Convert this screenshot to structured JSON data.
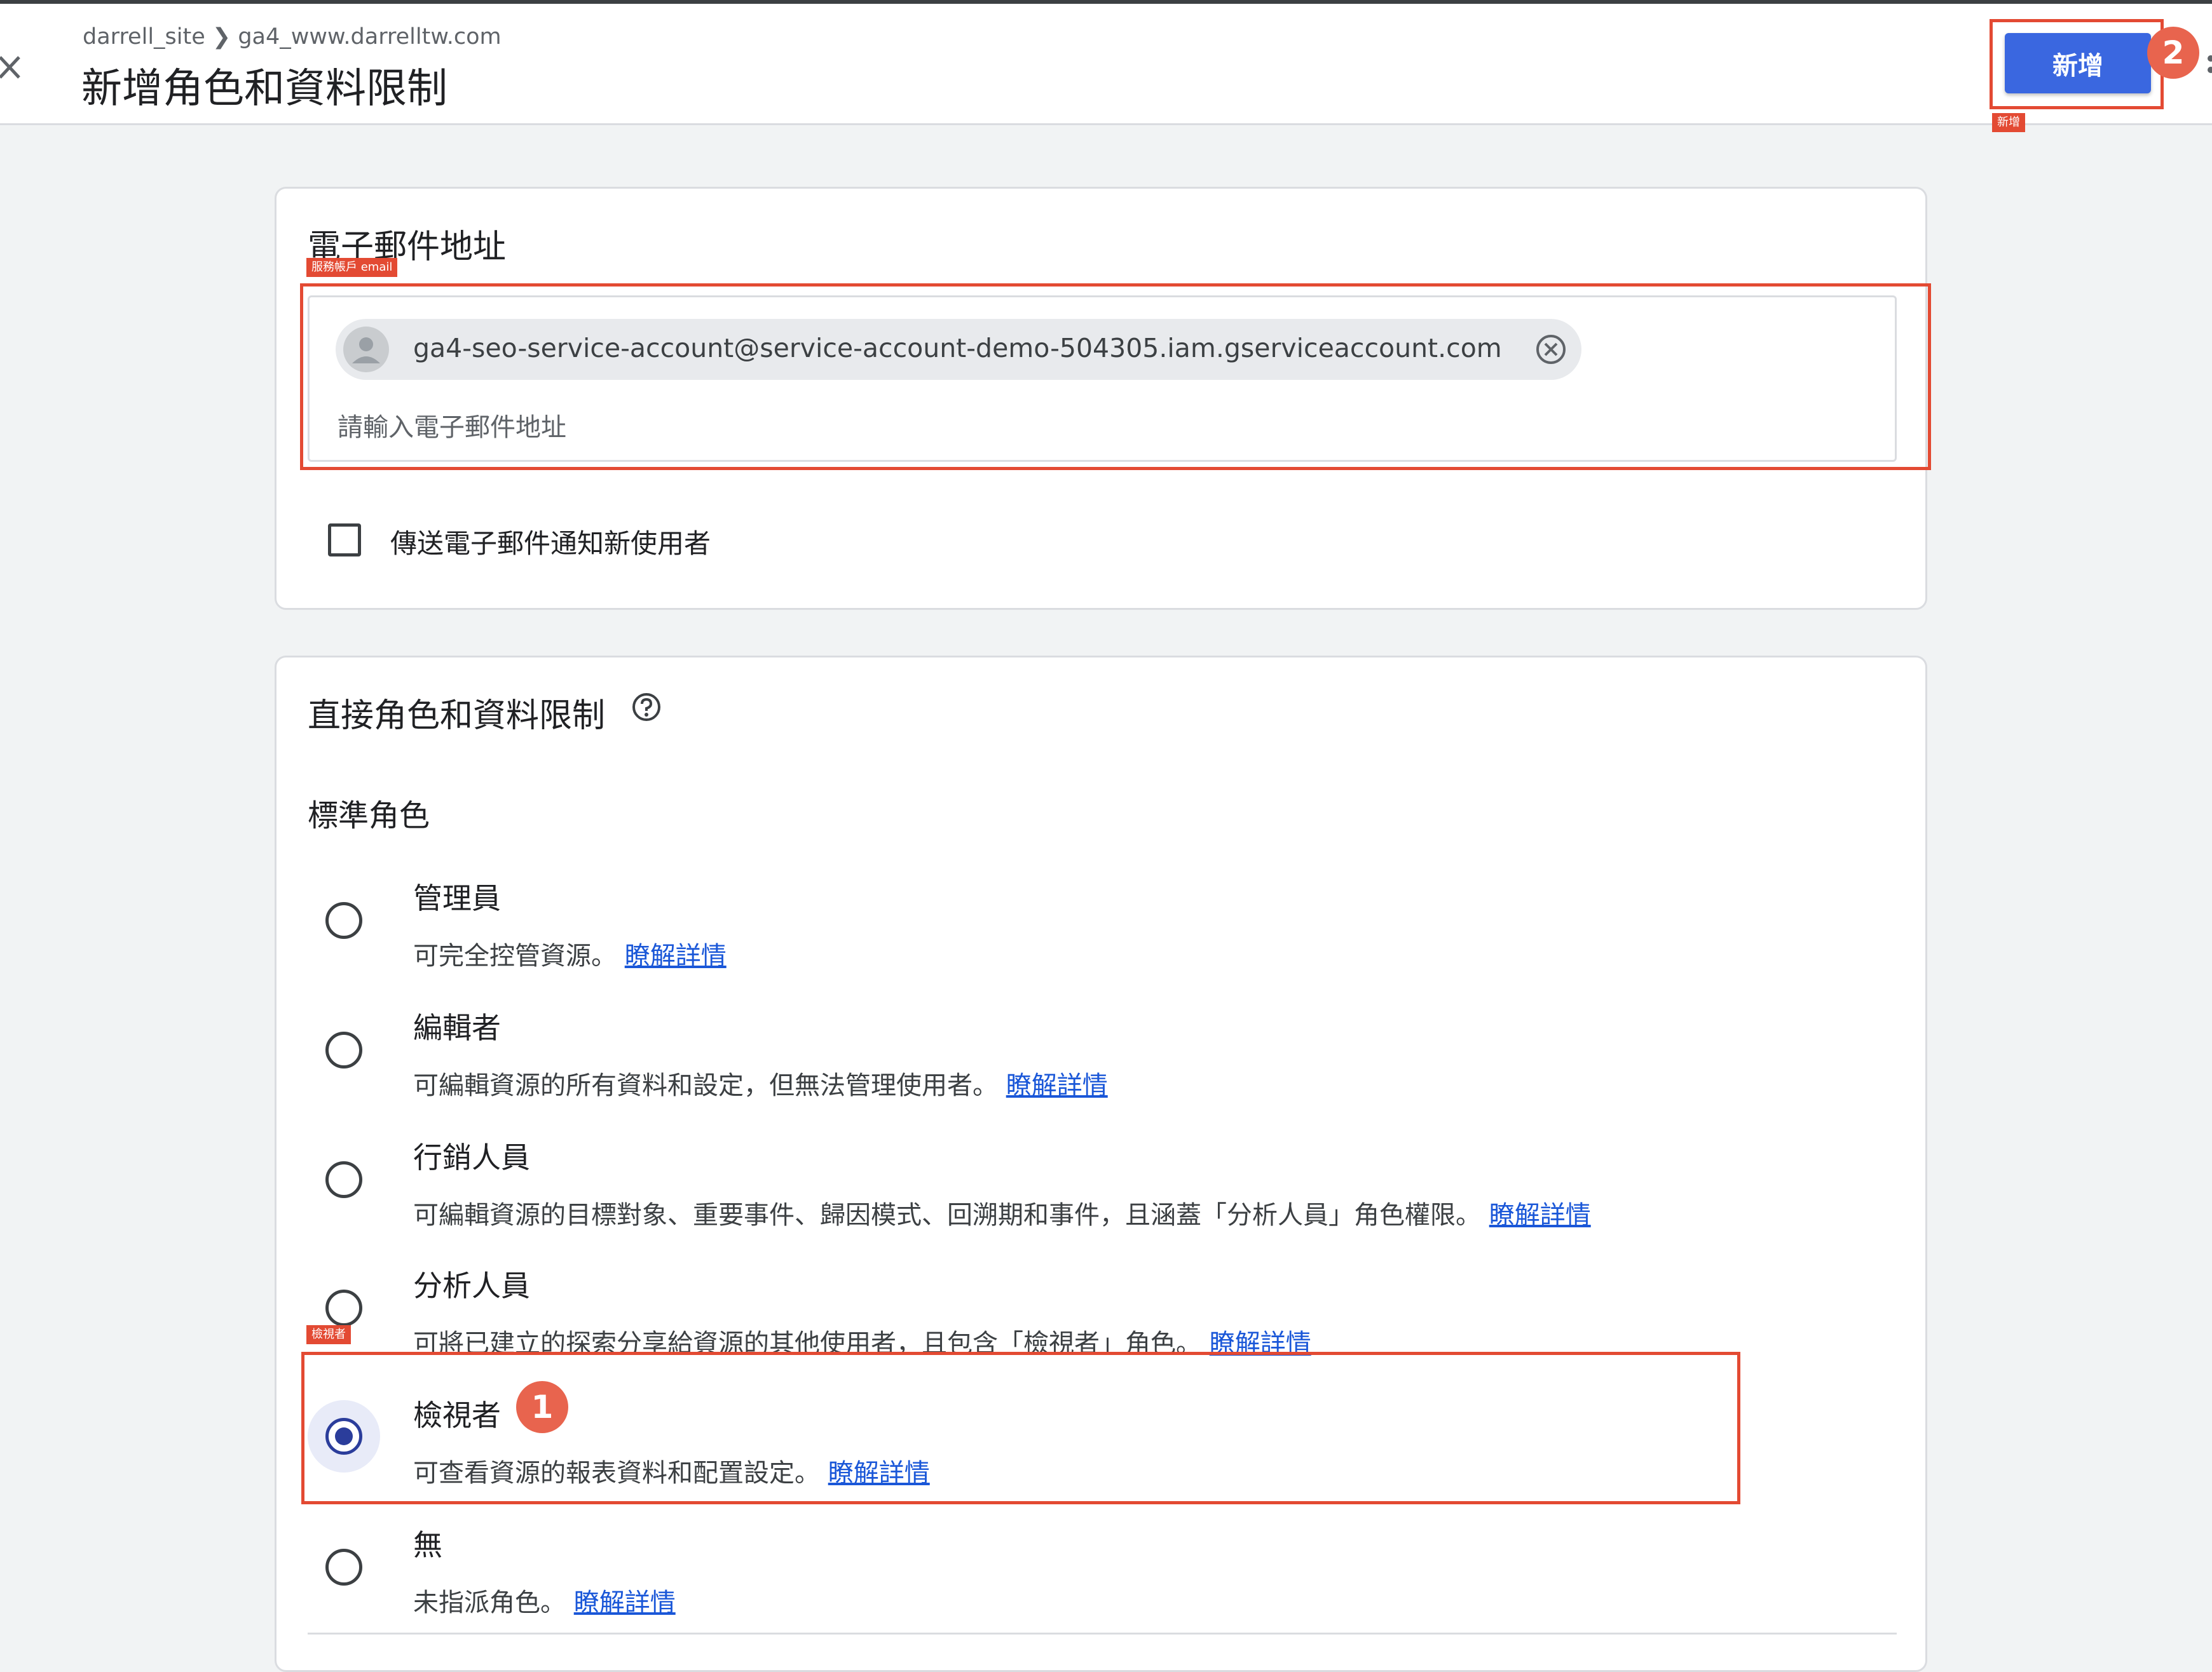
{
  "header": {
    "breadcrumb": "darrell_site ❯ ga4_www.darrelltw.com",
    "title": "新增角色和資料限制",
    "add_button": "新增"
  },
  "annotations": {
    "add_button_tag": "新增",
    "email_tag": "服務帳戶 email",
    "viewer_tag": "檢視者",
    "step1": "1",
    "step2": "2"
  },
  "email_section": {
    "title": "電子郵件地址",
    "chip_email": "ga4-seo-service-account@service-account-demo-504305.iam.gserviceaccount.com",
    "placeholder": "請輸入電子郵件地址",
    "notify_label": "傳送電子郵件通知新使用者",
    "notify_checked": false
  },
  "roles_section": {
    "title": "直接角色和資料限制",
    "standard_roles_label": "標準角色",
    "learn_more": "瞭解詳情",
    "selected_role": "檢視者",
    "roles": [
      {
        "name": "管理員",
        "desc": "可完全控管資源。"
      },
      {
        "name": "編輯者",
        "desc": "可編輯資源的所有資料和設定，但無法管理使用者。"
      },
      {
        "name": "行銷人員",
        "desc": "可編輯資源的目標對象、重要事件、歸因模式、回溯期和事件，且涵蓋「分析人員」角色權限。"
      },
      {
        "name": "分析人員",
        "desc": "可將已建立的探索分享給資源的其他使用者，且包含「檢視者」角色。"
      },
      {
        "name": "檢視者",
        "desc": "可查看資源的報表資料和配置設定。"
      },
      {
        "name": "無",
        "desc": "未指派角色。"
      }
    ]
  },
  "colors": {
    "primary_button": "#3a67e0",
    "annotation_red": "#e34a33",
    "link": "#1a57d8",
    "radio_checked": "#2b3d9b"
  },
  "icons": [
    "close-icon",
    "avatar-icon",
    "remove-chip-icon",
    "help-icon",
    "more-vert-icon"
  ]
}
